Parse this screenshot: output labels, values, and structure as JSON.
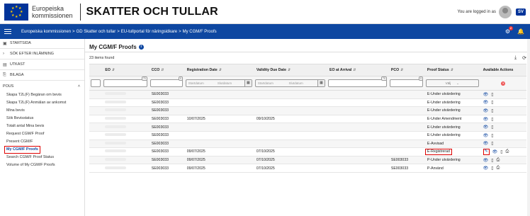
{
  "header": {
    "logo_line1": "Europeiska",
    "logo_line2": "kommissionen",
    "app_title": "SKATTER OCH TULLAR",
    "logged_in": "You are logged in as",
    "lang": "SV"
  },
  "breadcrumb": [
    "Europeiska kommissionen",
    ">",
    "GD Skatter och tullar",
    ">",
    "EU-tullportal för näringsidkare",
    ">",
    "My CGM/F Proofs"
  ],
  "notifications_count": "2",
  "sidebar": {
    "top_items": [
      {
        "label": "STARTSIDA",
        "icon": "save-icon"
      },
      {
        "label": "SÖK EFTER INLÄMNING",
        "icon": "chevron-right-icon"
      },
      {
        "label": "UTKAST",
        "icon": "draft-icon"
      },
      {
        "label": "BILAGA",
        "icon": "attachment-icon"
      }
    ],
    "section": "POUS",
    "items": [
      "Skapa T2L(F) Begäran om bevis",
      "Skapa T2L(F) Anmälan av ankomst",
      "Mina bevis",
      "Sök Bevisstatus",
      "Totalt antal Mina bevis",
      "Request CGM/F Proof",
      "Present CGM/F",
      "My CGM/F Proofs",
      "Search CGM/F Proof Status",
      "Volume of My CGM/F Proofs"
    ]
  },
  "main": {
    "title": "My CGM/F Proofs",
    "count": "23 items found"
  },
  "table": {
    "headers": [
      "EO",
      "CCO",
      "Registration Date",
      "Validity Due Date",
      "EO at Arrival",
      "PCO",
      "Proof Status",
      "Available Actions"
    ],
    "filters": {
      "start_placeholder": "Startdatum",
      "end_placeholder": "Slutdatum",
      "select_placeholder": "Välj",
      "tag_values": [
        "0",
        "70",
        "0",
        "70",
        "0"
      ]
    },
    "rows": [
      {
        "cco": "SE003033",
        "reg": "",
        "due": "",
        "pco": "",
        "status": "E-Under utvärdering",
        "edit": false,
        "extra": false
      },
      {
        "cco": "SE003033",
        "reg": "",
        "due": "",
        "pco": "",
        "status": "E-Under utvärdering",
        "edit": false,
        "extra": false
      },
      {
        "cco": "SE003033",
        "reg": "",
        "due": "",
        "pco": "",
        "status": "E-Under utvärdering",
        "edit": false,
        "extra": false
      },
      {
        "cco": "SE003033",
        "reg": "10/07/2025",
        "due": "09/10/2025",
        "pco": "",
        "status": "E-Under Amendment",
        "edit": false,
        "extra": false
      },
      {
        "cco": "SE003033",
        "reg": "",
        "due": "",
        "pco": "",
        "status": "E-Under utvärdering",
        "edit": false,
        "extra": false
      },
      {
        "cco": "SE003033",
        "reg": "",
        "due": "",
        "pco": "",
        "status": "E-Under utvärdering",
        "edit": false,
        "extra": false
      },
      {
        "cco": "SE003033",
        "reg": "",
        "due": "",
        "pco": "",
        "status": "E-Avvisad",
        "edit": false,
        "extra": false
      },
      {
        "cco": "SE003033",
        "reg": "09/07/2025",
        "due": "07/10/2025",
        "pco": "",
        "status": "E-Registrerad",
        "edit": true,
        "extra": true
      },
      {
        "cco": "SE003033",
        "reg": "09/07/2025",
        "due": "07/10/2025",
        "pco": "SE003033",
        "status": "P-Under utvärdering",
        "edit": false,
        "extra": true
      },
      {
        "cco": "SE003033",
        "reg": "09/07/2025",
        "due": "07/10/2025",
        "pco": "SE003033",
        "status": "P-Använd",
        "edit": false,
        "extra": true
      }
    ]
  },
  "colors": {
    "brand_blue": "#0e47a1",
    "highlight_red": "#dd0000"
  }
}
